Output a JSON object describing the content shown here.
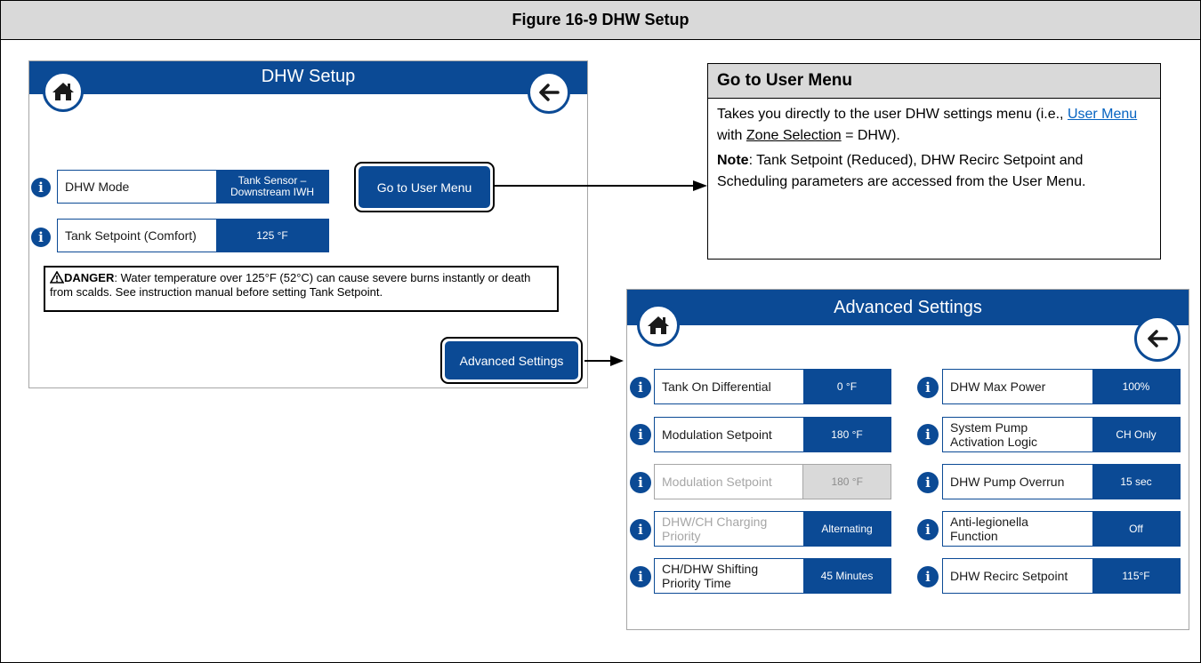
{
  "figure": {
    "title": "Figure 16-9 DHW Setup"
  },
  "colors": {
    "accent": "#0b4a95",
    "header_gray": "#d9d9d9",
    "disabled_gray": "#a6a6a6",
    "link": "#0563c1"
  },
  "dhw_screen": {
    "title": "DHW Setup",
    "home_icon": "home-icon",
    "back_icon": "back-arrow-icon",
    "params": [
      {
        "label": "DHW Mode",
        "value_line1": "Tank Sensor –",
        "value_line2": "Downstream IWH"
      },
      {
        "label": "Tank Setpoint (Comfort)",
        "value": "125 °F"
      }
    ],
    "go_user_menu_label": "Go to User Menu",
    "danger": {
      "prefix": "DANGER",
      "text": ": Water temperature over 125°F (52°C) can cause severe burns instantly or death from scalds.  See instruction manual before setting Tank Setpoint."
    },
    "advanced_settings_label": "Advanced Settings"
  },
  "callout": {
    "title": "Go to User Menu",
    "line1": "Takes you directly to the user DHW settings menu (i.e., ",
    "link1": "User Menu",
    "line1b": " with ",
    "link2": "Zone Selection",
    "line1c": " = DHW).",
    "note_label": "Note",
    "note_text": ": Tank Setpoint (Reduced), DHW Recirc Setpoint and Scheduling parameters are accessed from the User Menu."
  },
  "advanced_screen": {
    "title": "Advanced Settings",
    "left": [
      {
        "label1": "Tank On Differential",
        "label2": "",
        "value": "0 °F",
        "disabled": false
      },
      {
        "label1": "Modulation Setpoint",
        "label2": "",
        "value": "180 °F",
        "disabled": false
      },
      {
        "label1": "Modulation Setpoint",
        "label2": "",
        "value": "180 °F",
        "disabled": true
      },
      {
        "label1": "DHW/CH Charging",
        "label2": "Priority",
        "value": "Alternating",
        "disabled": true
      },
      {
        "label1": "CH/DHW Shifting",
        "label2": "Priority Time",
        "value": "45 Minutes",
        "disabled": false
      }
    ],
    "right": [
      {
        "label1": "DHW Max Power",
        "label2": "",
        "value": "100%"
      },
      {
        "label1": "System Pump",
        "label2": "Activation Logic",
        "value": "CH Only"
      },
      {
        "label1": "DHW Pump Overrun",
        "label2": "",
        "value": "15 sec"
      },
      {
        "label1": "Anti-legionella",
        "label2": "Function",
        "value": "Off"
      },
      {
        "label1": "DHW Recirc Setpoint",
        "label2": "",
        "value": "115°F"
      }
    ]
  }
}
